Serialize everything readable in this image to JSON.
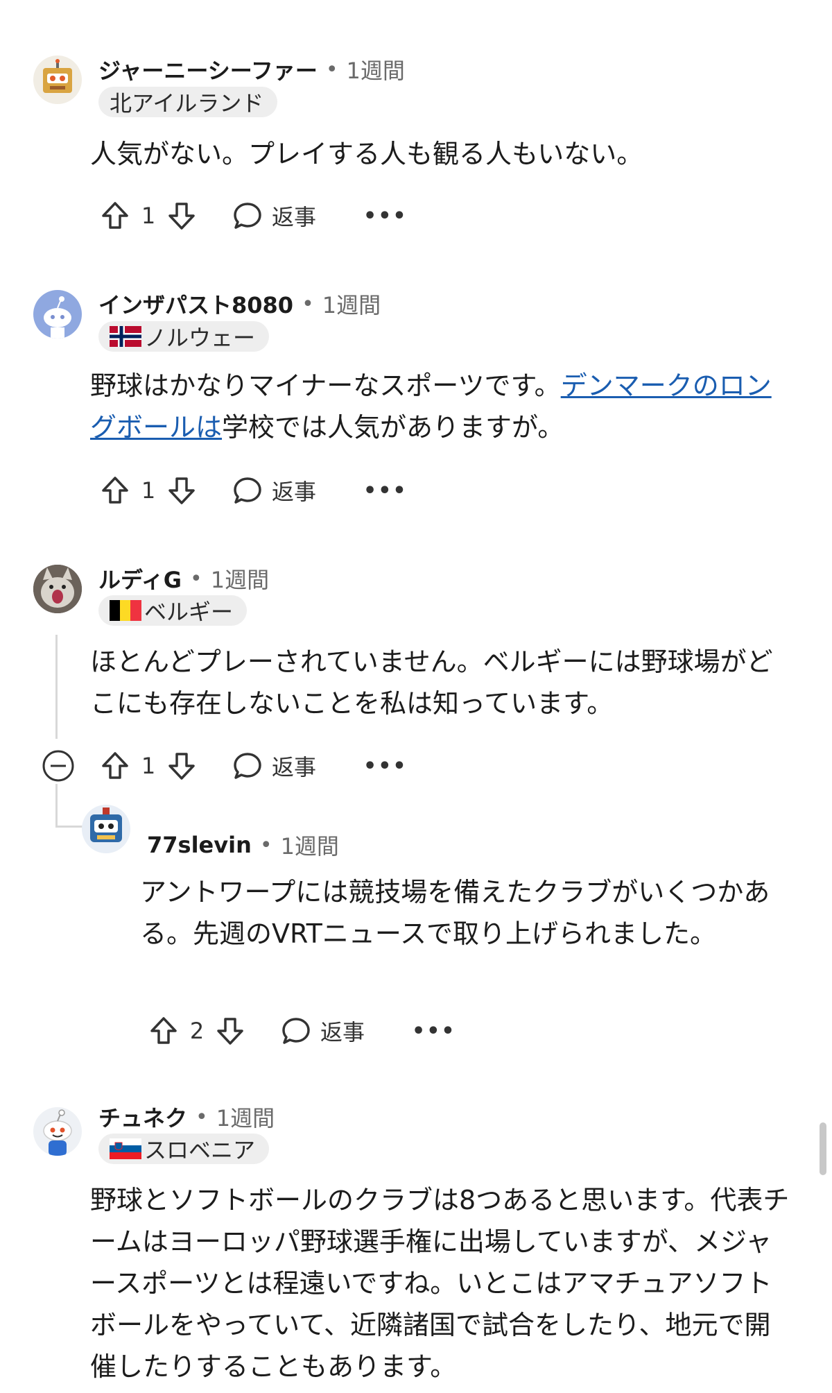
{
  "action_labels": {
    "reply": "返事",
    "more": "•••"
  },
  "comments": [
    {
      "author": "ジャーニーシーファー",
      "age": "1週間",
      "flair": "北アイルランド",
      "body": "人気がない。プレイする人も観る人もいない。",
      "score": "1"
    },
    {
      "author": "インザパスト8080",
      "age": "1週間",
      "flair": "ノルウェー",
      "body_before": "野球はかなりマイナーなスポーツです。",
      "body_link": "デンマークのロングボールは",
      "body_after": "学校では人気がありますが。",
      "score": "1"
    },
    {
      "author": "ルディG",
      "age": "1週間",
      "flair": "ベルギー",
      "body": "ほとんどプレーされていません。ベルギーには野球場がどこにも存在しないことを私は知っています。",
      "score": "1"
    },
    {
      "author": "77slevin",
      "age": "1週間",
      "body": "アントワープには競技場を備えたクラブがいくつかある。先週のVRTニュースで取り上げられました。",
      "score": "2"
    },
    {
      "author": "チュネク",
      "age": "1週間",
      "flair": "スロベニア",
      "body": "野球とソフトボールのクラブは8つあると思います。代表チームはヨーロッパ野球選手権に出場していますが、メジャースポーツとは程遠いですね。いとこはアマチュアソフトボールをやっていて、近隣諸国で試合をしたり、地元で開催したりすることもあります。"
    }
  ]
}
